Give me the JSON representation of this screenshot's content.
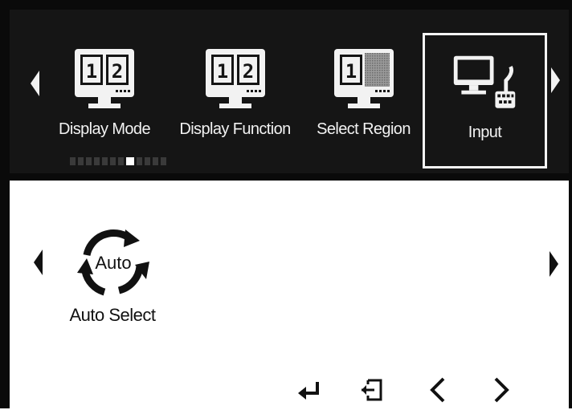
{
  "menu": {
    "items": [
      {
        "label": "Display Mode",
        "icon": "split-screen-12-icon",
        "left_num": "1",
        "right_num": "2"
      },
      {
        "label": "Display Function",
        "icon": "split-screen-12-icon",
        "left_num": "1",
        "right_num": "2"
      },
      {
        "label": "Select Region",
        "icon": "select-region-icon",
        "left_num": "1",
        "right_num": ""
      },
      {
        "label": "Input",
        "icon": "computer-input-icon",
        "selected": true
      }
    ],
    "pager": {
      "count": 12,
      "active_index": 7
    }
  },
  "content": {
    "item": {
      "label": "Auto Select",
      "icon_text": "Auto"
    }
  },
  "footer": {
    "buttons": [
      "enter-icon",
      "exit-icon",
      "previous-icon",
      "next-icon"
    ]
  }
}
